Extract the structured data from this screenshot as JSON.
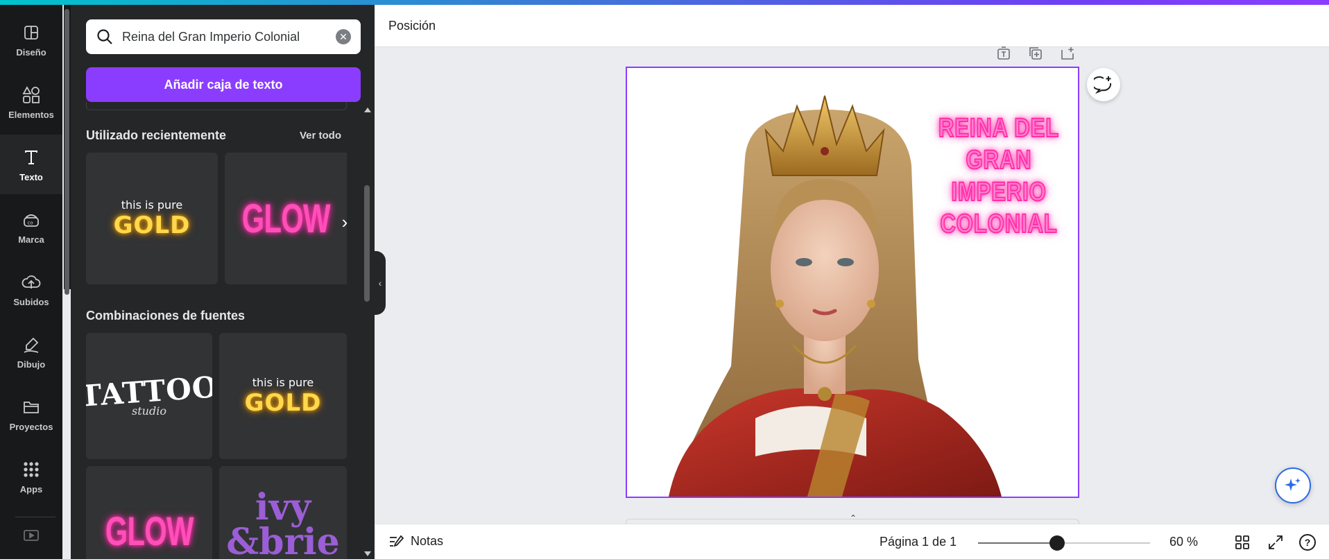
{
  "rail": {
    "items": [
      {
        "label": "Diseño",
        "icon": "layout-icon"
      },
      {
        "label": "Elementos",
        "icon": "shapes-icon"
      },
      {
        "label": "Texto",
        "icon": "text-icon"
      },
      {
        "label": "Marca",
        "icon": "brand-icon"
      },
      {
        "label": "Subidos",
        "icon": "cloud-upload-icon"
      },
      {
        "label": "Dibujo",
        "icon": "draw-icon"
      },
      {
        "label": "Proyectos",
        "icon": "folder-icon"
      },
      {
        "label": "Apps",
        "icon": "apps-grid-icon"
      }
    ],
    "active_index": 2
  },
  "panel": {
    "search_value": "Reina del Gran Imperio Colonial",
    "add_text_button": "Añadir caja de texto",
    "recent_title": "Utilizado recientemente",
    "see_all": "Ver todo",
    "font_combos_title": "Combinaciones de fuentes",
    "recent_cards": [
      {
        "small": "this is pure",
        "big": "GOLD"
      },
      {
        "big": "GLOW"
      }
    ],
    "combo_cards": [
      {
        "big": "TATTOO",
        "small": "studio"
      },
      {
        "small": "this is pure",
        "big": "GOLD"
      },
      {
        "big": "GLOW"
      },
      {
        "line1": "ivy",
        "line2": "&brie"
      }
    ]
  },
  "toolbar": {
    "position_label": "Posición"
  },
  "canvas": {
    "title_text": "REINA DEL GRAN IMPERIO COLONIAL",
    "accent_color": "#8b3dff",
    "neon_color": "#ff2ea6"
  },
  "bottombar": {
    "notes_label": "Notas",
    "page_indicator": "Página 1 de 1",
    "zoom_label": "60 %",
    "zoom_fraction": 0.46
  }
}
